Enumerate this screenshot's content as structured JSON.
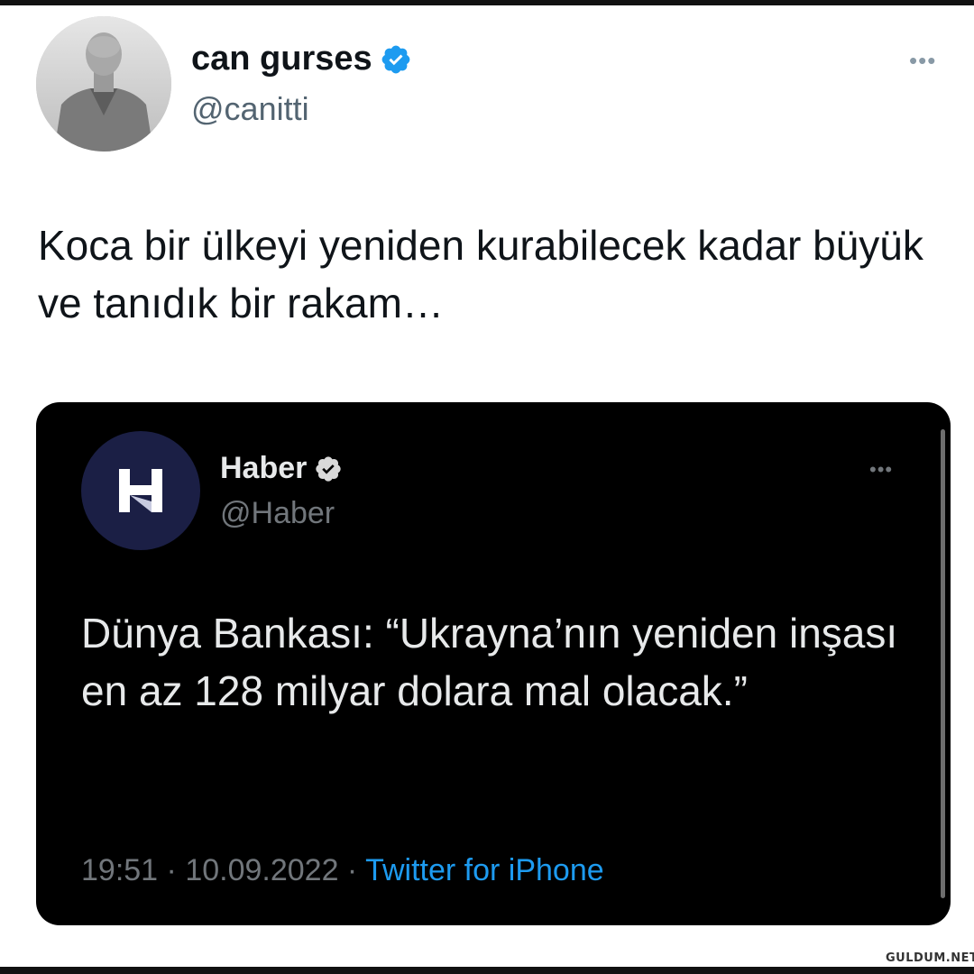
{
  "outer_tweet": {
    "display_name": "can gurses",
    "handle": "@canitti",
    "text": "Koca bir ülkeyi yeniden kurabilecek kadar büyük ve tanıdık bir rakam…",
    "more_label": "•••",
    "badge_icon": "verified-badge-icon",
    "avatar_icon": "profile-photo"
  },
  "quoted_tweet": {
    "display_name": "Haber",
    "handle": "@Haber",
    "text": "Dünya Bankası: “Ukrayna’nın yeniden inşası en az 128 milyar dolara mal olacak.”",
    "time": "19:51",
    "separator": " · ",
    "date": "10.09.2022",
    "source": "Twitter for iPhone",
    "more_label": "•••",
    "avatar_icon": "haber-logo"
  },
  "watermark": "GULDUM.NET",
  "colors": {
    "verified": "#1d9bf0",
    "embed_bg": "#000000",
    "link": "#1d9bf0",
    "haber_avatar_bg": "#1b1f45"
  }
}
